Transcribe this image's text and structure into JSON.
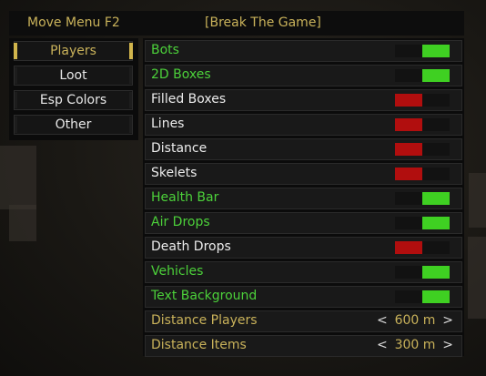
{
  "header": {
    "move_hint": "Move Menu F2",
    "title": "[Break The Game]"
  },
  "sidebar": {
    "items": [
      {
        "label": "Players",
        "active": true
      },
      {
        "label": "Loot",
        "active": false
      },
      {
        "label": "Esp Colors",
        "active": false
      },
      {
        "label": "Other",
        "active": false
      }
    ]
  },
  "toggles": [
    {
      "label": "Bots",
      "enabled": true
    },
    {
      "label": "2D Boxes",
      "enabled": true
    },
    {
      "label": "Filled Boxes",
      "enabled": false
    },
    {
      "label": "Lines",
      "enabled": false
    },
    {
      "label": "Distance",
      "enabled": false
    },
    {
      "label": "Skelets",
      "enabled": false
    },
    {
      "label": "Health Bar",
      "enabled": true
    },
    {
      "label": "Air Drops",
      "enabled": true
    },
    {
      "label": "Death Drops",
      "enabled": false
    },
    {
      "label": "Vehicles",
      "enabled": true
    },
    {
      "label": "Text Background",
      "enabled": true
    }
  ],
  "selectors": [
    {
      "label": "Distance Players",
      "value": "600 m"
    },
    {
      "label": "Distance Items",
      "value": "300 m"
    }
  ],
  "arrows": {
    "left": "<",
    "right": ">"
  },
  "colors": {
    "accent": "#c9b25a",
    "on": "#3fd022",
    "off": "#b10e0e",
    "on_text": "#4cd13a"
  }
}
